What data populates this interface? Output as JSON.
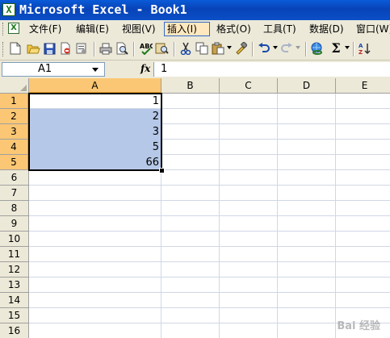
{
  "window": {
    "title": "Microsoft Excel - Book1"
  },
  "menu": {
    "items": [
      {
        "label": "文件(F)"
      },
      {
        "label": "编辑(E)"
      },
      {
        "label": "视图(V)"
      },
      {
        "label": "插入(I)"
      },
      {
        "label": "格式(O)"
      },
      {
        "label": "工具(T)"
      },
      {
        "label": "数据(D)"
      },
      {
        "label": "窗口(W)"
      }
    ],
    "active": "插入(I)"
  },
  "toolbar": {
    "icons": [
      "new-icon",
      "open-icon",
      "save-icon",
      "permission-icon",
      "email-icon",
      "print-icon",
      "print-preview-icon",
      "spelling-icon",
      "research-icon",
      "cut-icon",
      "copy-icon",
      "paste-icon",
      "format-painter-icon",
      "undo-icon",
      "redo-icon",
      "hyperlink-icon",
      "autosum-icon"
    ],
    "autosum_symbol": "Σ"
  },
  "formula_bar": {
    "name_box": "A1",
    "fx_label": "fx",
    "formula": "1"
  },
  "grid": {
    "columns": [
      "A",
      "B",
      "C",
      "D",
      "E"
    ],
    "rows": [
      "1",
      "2",
      "3",
      "4",
      "5",
      "6",
      "7",
      "8",
      "9",
      "10",
      "11",
      "12",
      "13",
      "14",
      "15",
      "16"
    ],
    "selected_column": "A",
    "selected_rows": [
      "1",
      "2",
      "3",
      "4",
      "5"
    ],
    "selection_range": "A1:A5",
    "cells": [
      {
        "ref": "A1",
        "value": "1"
      },
      {
        "ref": "A2",
        "value": "2"
      },
      {
        "ref": "A3",
        "value": "3"
      },
      {
        "ref": "A4",
        "value": "5"
      },
      {
        "ref": "A5",
        "value": "66"
      }
    ]
  },
  "colors": {
    "titlebar": "#0a4fc8",
    "selection_fill": "#b6c8e8",
    "header_selected": "#fbc774",
    "menu_active": "#ffe8c0"
  },
  "watermark": {
    "text": "Bai 经验"
  }
}
